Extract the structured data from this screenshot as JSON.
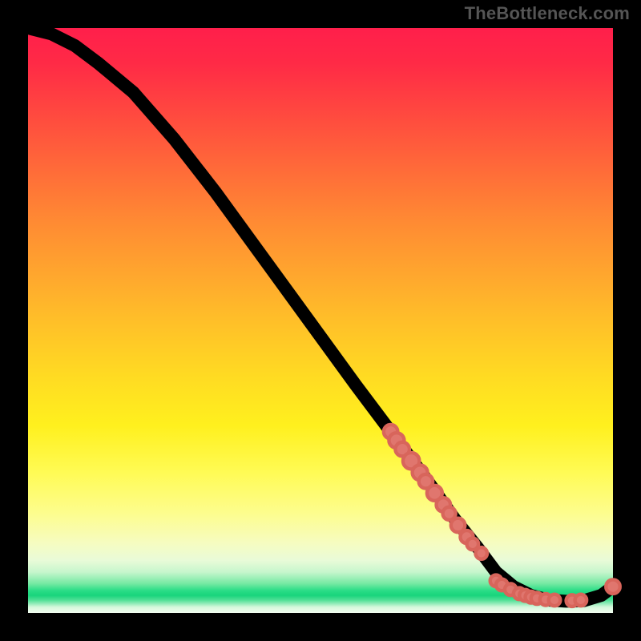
{
  "watermark": "TheBottleneck.com",
  "chart_data": {
    "type": "line",
    "title": "",
    "xlabel": "",
    "ylabel": "",
    "xlim": [
      0,
      100
    ],
    "ylim": [
      0,
      100
    ],
    "grid": false,
    "series": [
      {
        "name": "curve",
        "x": [
          0,
          4,
          8,
          12,
          18,
          25,
          32,
          40,
          48,
          56,
          62,
          68,
          73,
          77,
          80,
          83,
          86,
          89,
          92,
          95,
          98,
          100
        ],
        "y": [
          100,
          99,
          97,
          94,
          89,
          81,
          72,
          61,
          50,
          39,
          31,
          23,
          16,
          11,
          7,
          4.5,
          3,
          2.2,
          2,
          2.1,
          3,
          4.5
        ]
      }
    ],
    "scatter": {
      "name": "highlight-points",
      "color": "#e0766e",
      "points": [
        {
          "x": 62,
          "y": 31,
          "r": 1.2
        },
        {
          "x": 63,
          "y": 29.5,
          "r": 1.3
        },
        {
          "x": 64,
          "y": 28,
          "r": 1.2
        },
        {
          "x": 65.5,
          "y": 26,
          "r": 1.4
        },
        {
          "x": 67,
          "y": 24,
          "r": 1.3
        },
        {
          "x": 68,
          "y": 22.5,
          "r": 1.2
        },
        {
          "x": 69.5,
          "y": 20.5,
          "r": 1.3
        },
        {
          "x": 71,
          "y": 18.5,
          "r": 1.2
        },
        {
          "x": 72,
          "y": 17,
          "r": 1.1
        },
        {
          "x": 73.5,
          "y": 15,
          "r": 1.2
        },
        {
          "x": 75,
          "y": 13,
          "r": 1.1
        },
        {
          "x": 76,
          "y": 11.8,
          "r": 1.0
        },
        {
          "x": 77.5,
          "y": 10.2,
          "r": 1.0
        },
        {
          "x": 80,
          "y": 5.5,
          "r": 1.0
        },
        {
          "x": 81,
          "y": 4.8,
          "r": 1.0
        },
        {
          "x": 82.5,
          "y": 4.0,
          "r": 1.0
        },
        {
          "x": 84,
          "y": 3.3,
          "r": 1.0
        },
        {
          "x": 85,
          "y": 3.0,
          "r": 1.0
        },
        {
          "x": 86,
          "y": 2.7,
          "r": 1.0
        },
        {
          "x": 87,
          "y": 2.5,
          "r": 1.0
        },
        {
          "x": 88.5,
          "y": 2.3,
          "r": 1.0
        },
        {
          "x": 90,
          "y": 2.2,
          "r": 1.0
        },
        {
          "x": 93,
          "y": 2.1,
          "r": 1.0
        },
        {
          "x": 94.5,
          "y": 2.2,
          "r": 1.0
        },
        {
          "x": 100,
          "y": 4.5,
          "r": 1.2
        }
      ]
    }
  }
}
